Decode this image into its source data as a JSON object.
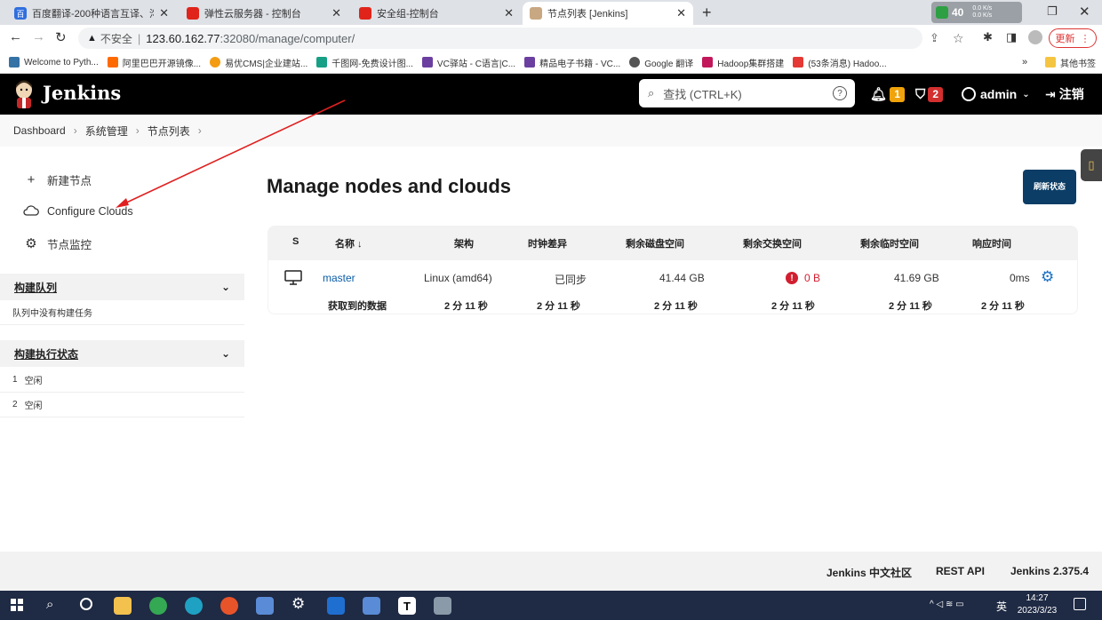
{
  "browser": {
    "tabs": [
      {
        "title": "百度翻译-200种语言互译、沟通",
        "fav": "百"
      },
      {
        "title": "弹性云服务器 - 控制台",
        "fav": ""
      },
      {
        "title": "安全组-控制台",
        "fav": ""
      },
      {
        "title": "节点列表 [Jenkins]",
        "fav": ""
      }
    ],
    "ext_badge": "40",
    "net_up": "0.0 K/s",
    "net_down": "0.0 K/s",
    "security_label": "不安全",
    "url_host": "123.60.162.77",
    "url_rest": ":32080/manage/computer/",
    "update_label": "更新",
    "bookmarks": [
      "Welcome to Pyth...",
      "阿里巴巴开源镜像...",
      "易优CMS|企业建站...",
      "千图网-免费设计图...",
      "VC驿站 - C语言|C...",
      "精品电子书籍 - VC...",
      "Google 翻译",
      "Hadoop集群搭建",
      "(53条消息) Hadoo..."
    ],
    "other_bookmarks": "其他书签"
  },
  "header": {
    "brand": "Jenkins",
    "search_placeholder": "查找 (CTRL+K)",
    "notifications_count": "1",
    "security_count": "2",
    "user": "admin",
    "logout": "注销"
  },
  "breadcrumb": [
    "Dashboard",
    "系统管理",
    "节点列表"
  ],
  "sidebar": {
    "links": [
      "新建节点",
      "Configure Clouds",
      "节点监控"
    ],
    "queue_title": "构建队列",
    "queue_empty": "队列中没有构建任务",
    "executors_title": "构建执行状态",
    "executors": [
      {
        "num": "1",
        "status": "空闲"
      },
      {
        "num": "2",
        "status": "空闲"
      }
    ]
  },
  "main": {
    "title": "Manage nodes and clouds",
    "refresh_label": "刷新状态",
    "columns": [
      "S",
      "名称 ↓",
      "架构",
      "时钟差异",
      "剩余磁盘空间",
      "剩余交换空间",
      "剩余临时空间",
      "响应时间"
    ],
    "row": {
      "name": "master",
      "arch": "Linux (amd64)",
      "clock": "已同步",
      "disk": "41.44 GB",
      "swap": "0 B",
      "temp": "41.69 GB",
      "response": "0ms"
    },
    "fetched_label": "获取到的数据",
    "fetched_values": [
      "2 分 11 秒",
      "2 分 11 秒",
      "2 分 11 秒",
      "2 分 11 秒",
      "2 分 11 秒",
      "2 分 11 秒"
    ]
  },
  "footer": {
    "community": "Jenkins 中文社区",
    "rest_api": "REST API",
    "version": "Jenkins 2.375.4"
  },
  "taskbar": {
    "time": "14:27",
    "date": "2023/3/23",
    "ime": "英"
  },
  "colors": {
    "jenkins_header": "#000000",
    "refresh_button": "#0b3d66",
    "warning_badge": "#f0a30a",
    "security_badge": "#d32f2f",
    "link_blue": "#0b5ca8",
    "swap_red": "#d21f2f"
  }
}
